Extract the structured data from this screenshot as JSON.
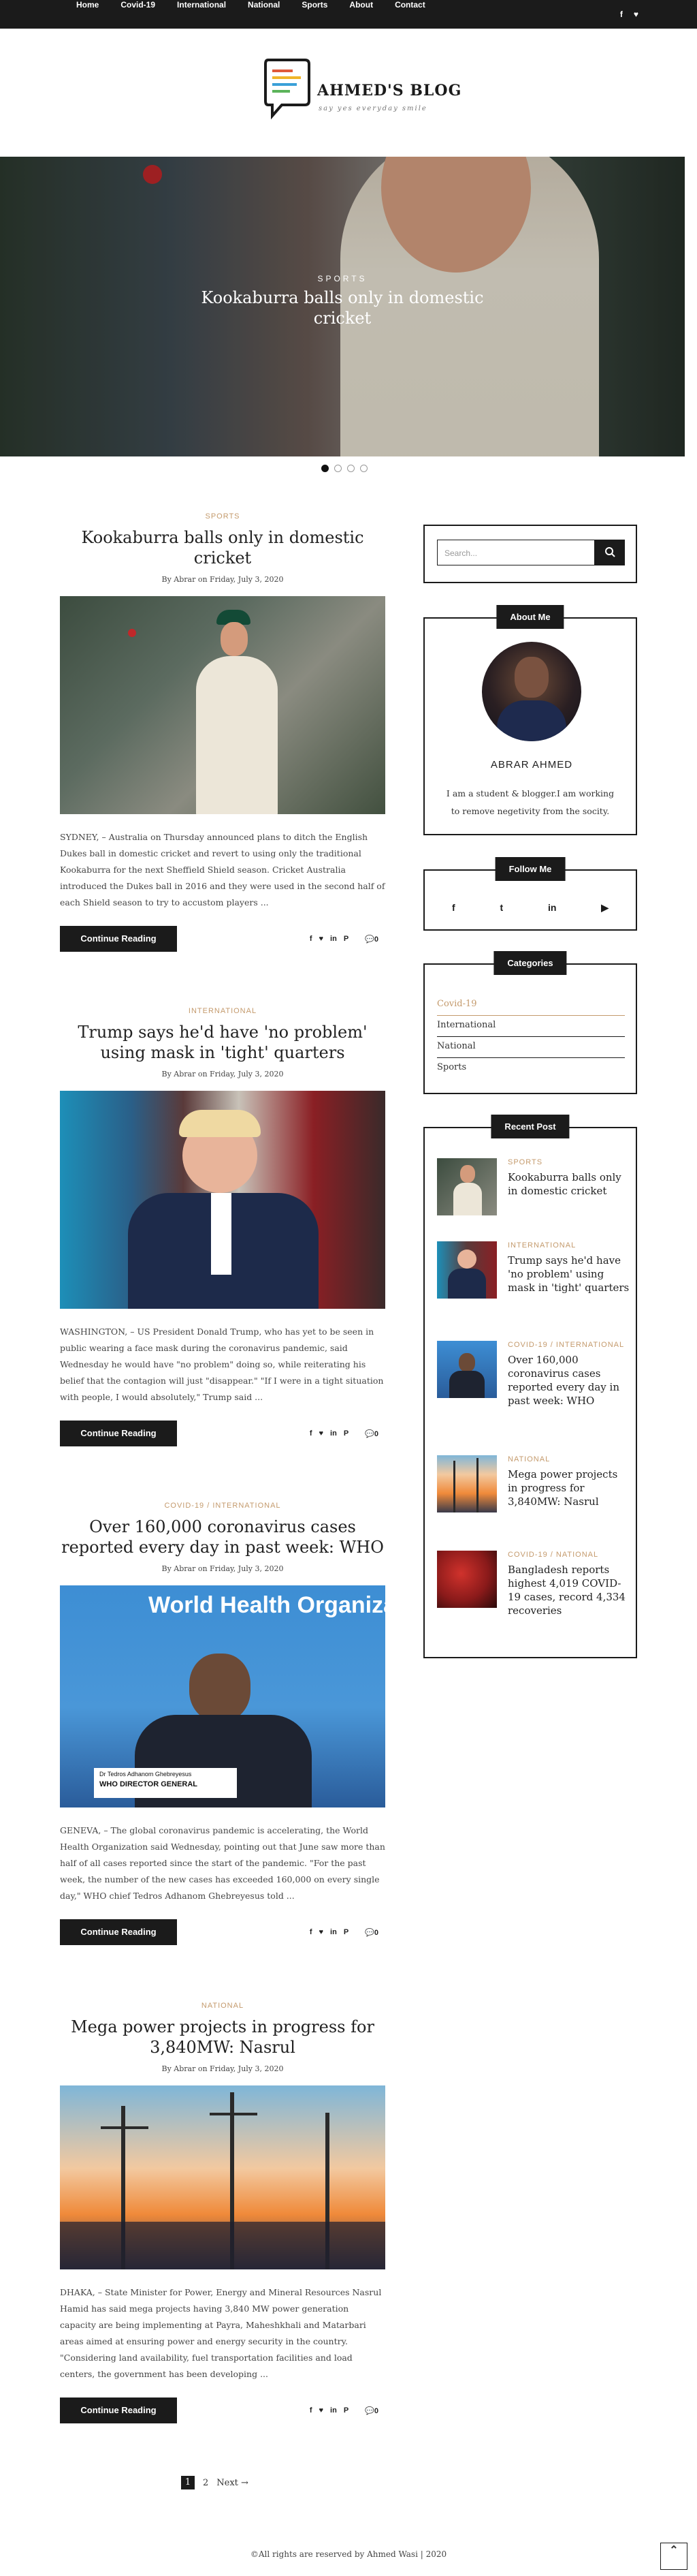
{
  "nav": {
    "items": [
      "Home",
      "Covid-19",
      "International",
      "National",
      "Sports",
      "About",
      "Contact"
    ],
    "social": [
      "f",
      "♥"
    ]
  },
  "logo": {
    "name": "AHMED'S BLOG",
    "tagline": "say yes everyday smile"
  },
  "hero": {
    "category": "SPORTS",
    "title": "Kookaburra balls only in domestic cricket",
    "slides": 4,
    "active_slide": 1
  },
  "posts": [
    {
      "category": "SPORTS",
      "title": "Kookaburra balls only in domestic cricket",
      "meta": "By Abrar on Friday, July 3, 2020",
      "excerpt": "SYDNEY, – Australia on Thursday announced plans to ditch the English Dukes ball in domestic cricket and revert to using only the traditional Kookaburra for the next Sheffield Shield season. Cricket Australia introduced the Dukes ball in 2016 and they were used in the second half of each Shield season to try to accustom players ...",
      "button": "Continue Reading",
      "comments": "0"
    },
    {
      "category": "INTERNATIONAL",
      "title": "Trump says he'd have 'no problem' using mask in 'tight' quarters",
      "meta": "By Abrar on Friday, July 3, 2020",
      "excerpt": "WASHINGTON, – US President Donald Trump, who has yet to be seen in public wearing a face mask during the coronavirus pandemic, said Wednesday he would have \"no problem\" doing so, while reiterating his belief that the contagion will just \"disappear.\" \"If I were in a tight situation with people, I would absolutely,\" Trump said ...",
      "button": "Continue Reading",
      "comments": "0"
    },
    {
      "category": "COVID-19 / INTERNATIONAL",
      "title": "Over 160,000 coronavirus cases reported every day in past week: WHO",
      "meta": "By Abrar on Friday, July 3, 2020",
      "excerpt": "GENEVA, – The global coronavirus pandemic is accelerating, the World Health Organization said Wednesday, pointing out that June saw more than half of all cases reported since the start of the pandemic. \"For the past week, the number of the new cases has exceeded 160,000 on every single day,\" WHO chief Tedros Adhanom Ghebreyesus told ...",
      "button": "Continue Reading",
      "comments": "0",
      "caption_name": "Dr Tedros Adhanom Ghebreyesus",
      "caption_role": "WHO DIRECTOR GENERAL",
      "banner": "World Health Organization"
    },
    {
      "category": "NATIONAL",
      "title": "Mega power projects in progress for 3,840MW: Nasrul",
      "meta": "By Abrar on Friday, July 3, 2020",
      "excerpt": "DHAKA, – State Minister for Power, Energy and Mineral Resources Nasrul Hamid has said mega projects having 3,840 MW power generation capacity are being implementing at Payra, Maheshkhali and Matarbari areas aimed at ensuring power and energy security in the country. \"Considering land availability, fuel transportation facilities and load centers, the government has been developing ...",
      "button": "Continue Reading",
      "comments": "0"
    }
  ],
  "share_icons": [
    "f",
    "♥",
    "in",
    "P"
  ],
  "pagination": {
    "current": "1",
    "next_page": "2",
    "next_label": "Next →"
  },
  "sidebar": {
    "search_placeholder": "Search...",
    "about": {
      "heading": "About Me",
      "name": "ABRAR AHMED",
      "bio": "I am a student & blogger.I am working to remove negetivity from the socity."
    },
    "follow": {
      "heading": "Follow Me",
      "icons": [
        "f",
        "t",
        "in",
        "▶"
      ]
    },
    "categories": {
      "heading": "Categories",
      "items": [
        "Covid-19",
        "International",
        "National",
        "Sports"
      ]
    },
    "recent": {
      "heading": "Recent Post",
      "items": [
        {
          "category": "SPORTS",
          "title": "Kookaburra balls only in domestic cricket"
        },
        {
          "category": "INTERNATIONAL",
          "title": "Trump says he'd have 'no problem' using mask in 'tight' quarters"
        },
        {
          "category": "COVID-19 / INTERNATIONAL",
          "title": "Over 160,000 coronavirus cases reported every day in past week: WHO"
        },
        {
          "category": "NATIONAL",
          "title": "Mega power projects in progress for 3,840MW: Nasrul"
        },
        {
          "category": "COVID-19 / NATIONAL",
          "title": "Bangladesh reports highest 4,019 COVID-19 cases, record 4,334 recoveries"
        }
      ]
    }
  },
  "footer": "©All rights are reserved by Ahmed Wasi | 2020",
  "colors": {
    "accent": "#c49a6c",
    "dark": "#1b1b1b"
  }
}
